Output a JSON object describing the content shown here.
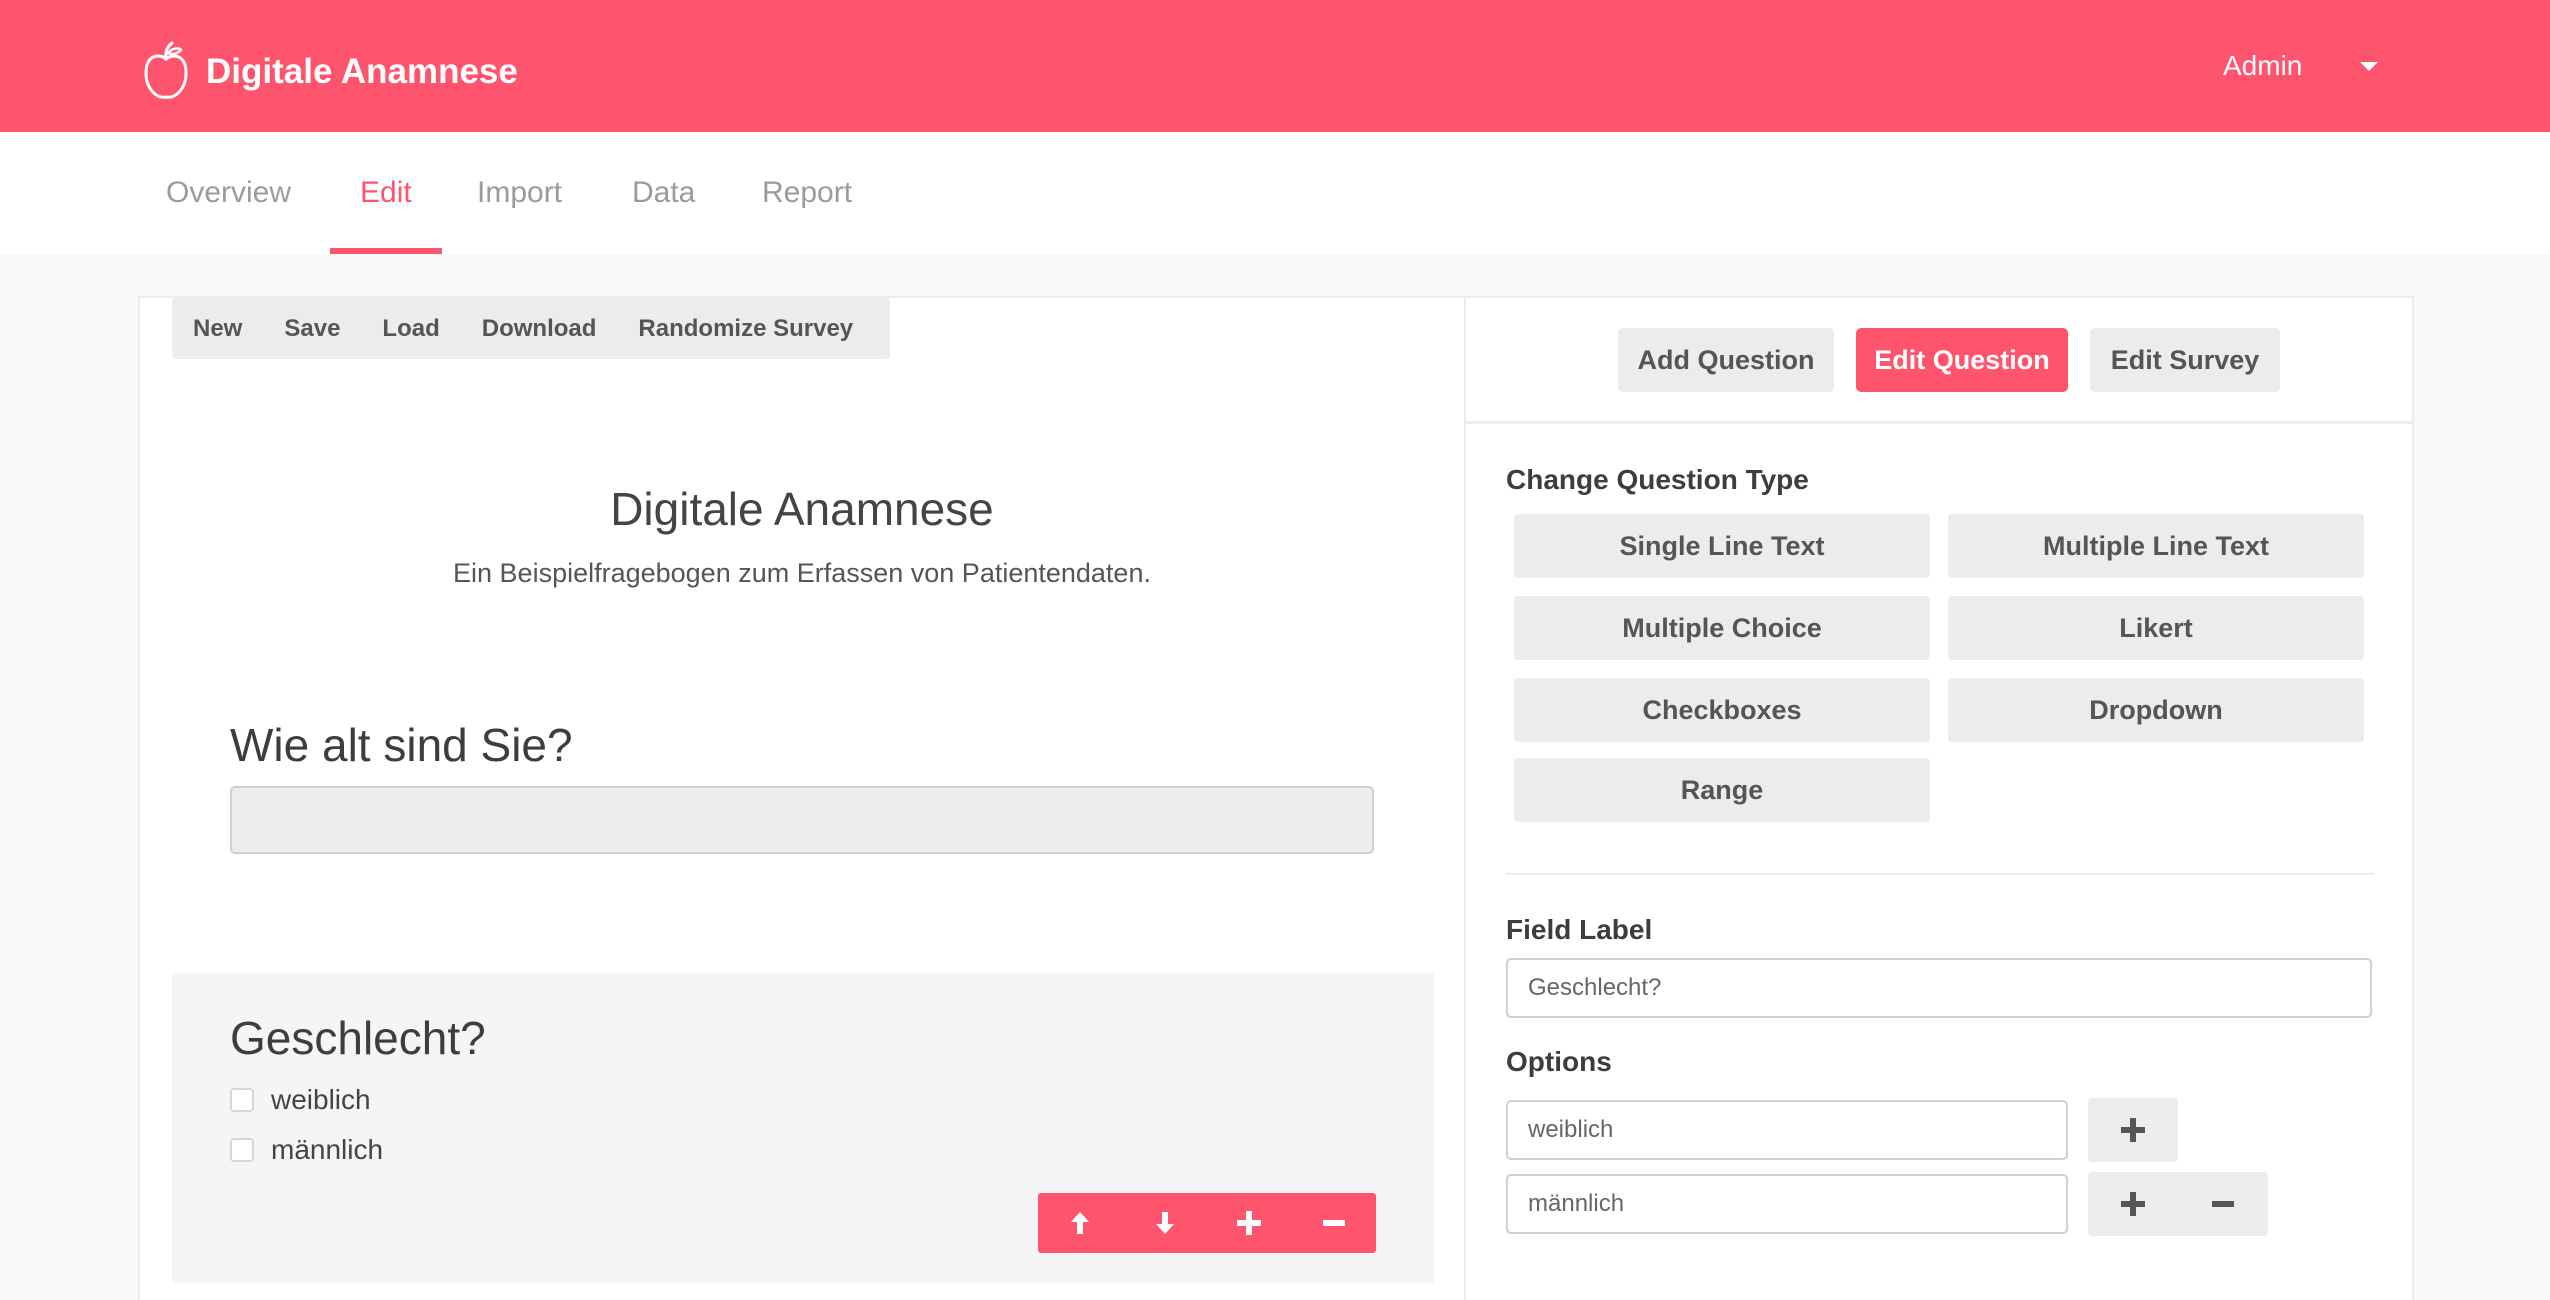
{
  "app": {
    "title": "Digitale Anamnese",
    "user": "Admin"
  },
  "nav": {
    "tabs": [
      {
        "label": "Overview"
      },
      {
        "label": "Edit"
      },
      {
        "label": "Import"
      },
      {
        "label": "Data"
      },
      {
        "label": "Report"
      }
    ],
    "active": "Edit"
  },
  "toolbar": {
    "items": [
      "New",
      "Save",
      "Load",
      "Download",
      "Randomize Survey"
    ]
  },
  "survey": {
    "title": "Digitale Anamnese",
    "description": "Ein Beispielfragebogen zum Erfassen von Patientendaten.",
    "questions": [
      {
        "title": "Wie alt sind Sie?",
        "type": "text",
        "value": ""
      },
      {
        "title": "Geschlecht?",
        "type": "checkboxes",
        "options": [
          "weiblich",
          "männlich"
        ]
      }
    ]
  },
  "editor": {
    "modes": [
      "Add Question",
      "Edit Question",
      "Edit Survey"
    ],
    "active_mode": "Edit Question",
    "change_type_label": "Change Question Type",
    "types": [
      "Single Line Text",
      "Multiple Line Text",
      "Multiple Choice",
      "Likert",
      "Checkboxes",
      "Dropdown",
      "Range"
    ],
    "field_label": "Field Label",
    "field_value": "Geschlecht?",
    "options_label": "Options",
    "options": [
      "weiblich",
      "männlich"
    ]
  },
  "colors": {
    "accent": "#ff546d",
    "button_gray": "#ececec",
    "text": "#4a4a4a"
  },
  "icons": {
    "brand": "apple-icon",
    "user_menu": "caret-down-icon",
    "move_up": "arrow-up-icon",
    "move_down": "arrow-down-icon",
    "add": "plus-icon",
    "remove": "minus-icon"
  }
}
